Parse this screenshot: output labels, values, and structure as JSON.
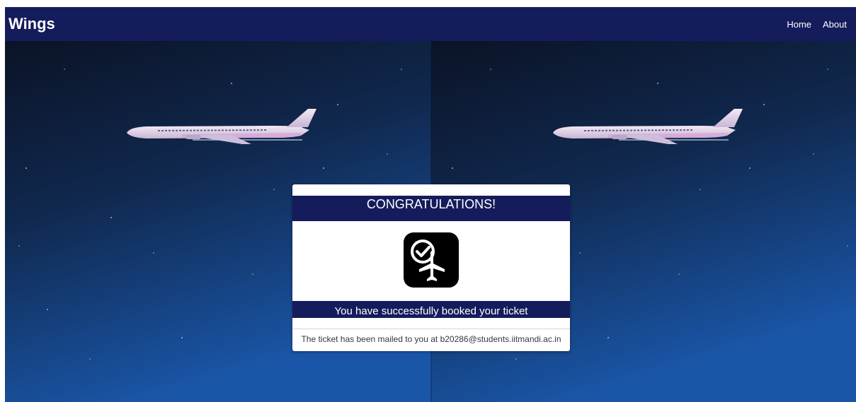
{
  "navbar": {
    "brand": "Wings",
    "links": [
      "Home",
      "About"
    ]
  },
  "card": {
    "title": "CONGRATULATIONS!",
    "icon": "flight-confirmed-icon",
    "message": "You have successfully booked your ticket",
    "note": "The ticket has been mailed to you at b20286@students.iitmandi.ac.in"
  },
  "colors": {
    "navbar_bg": "#141c5c",
    "card_bands": "#141c5c",
    "sky_top": "#0b1326",
    "sky_bottom": "#1a56a8",
    "icon_bg": "#000000"
  }
}
